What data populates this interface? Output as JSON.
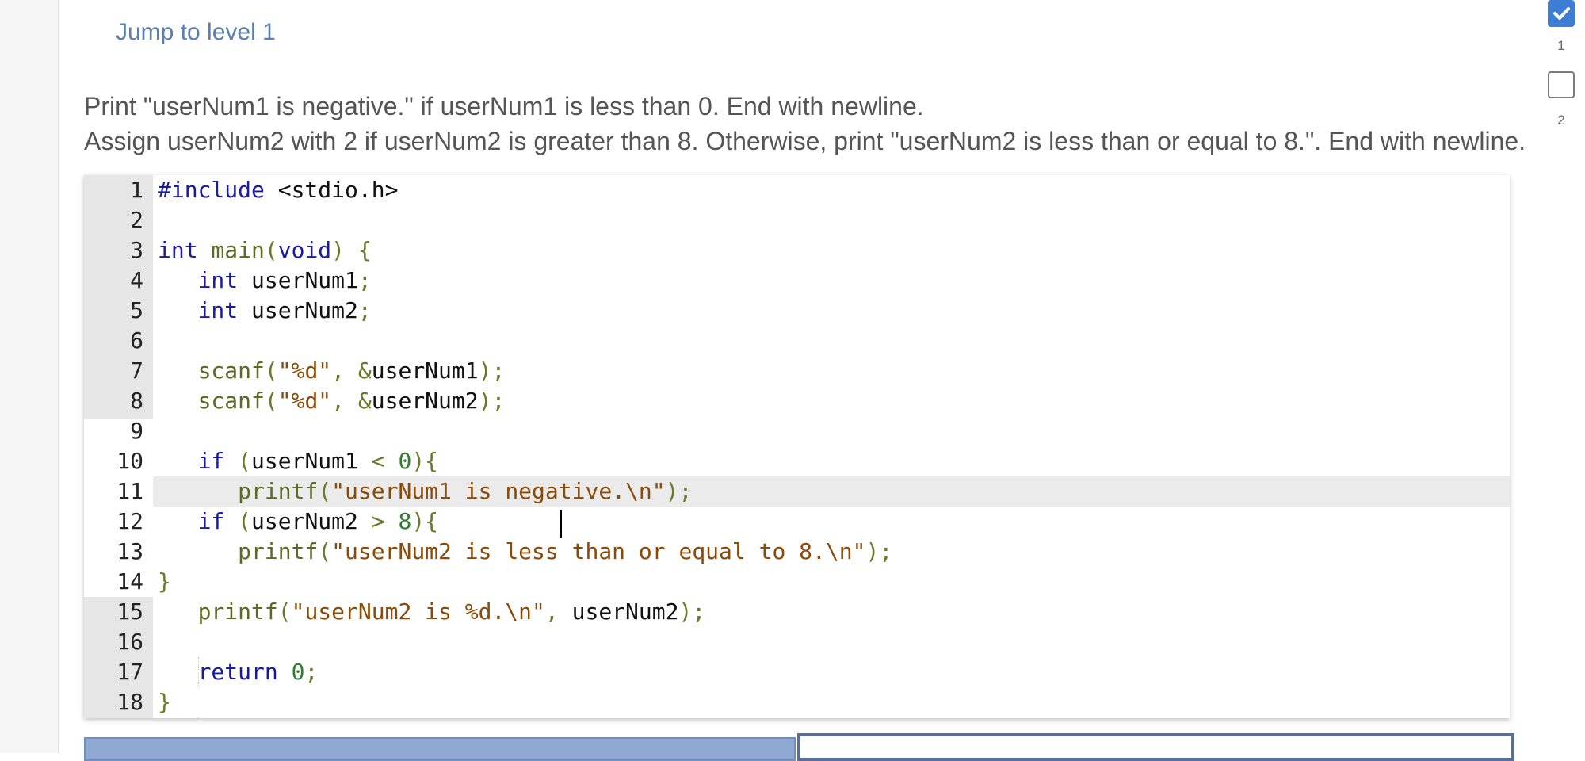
{
  "jump_link": "Jump to level 1",
  "instructions": [
    "Print \"userNum1 is negative.\" if userNum1 is less than 0. End with newline.",
    "Assign userNum2 with 2 if userNum2 is greater than 8. Otherwise, print \"userNum2 is less than or equal to 8.\". End with newline."
  ],
  "progress": {
    "levels": [
      {
        "number": "1",
        "state": "completed",
        "icon": "checkbox-checked-icon"
      },
      {
        "number": "2",
        "state": "incomplete",
        "icon": "checkbox-empty-icon"
      }
    ]
  },
  "editor": {
    "active_line": 11,
    "lines": [
      {
        "n": "1",
        "text": "#include <stdio.h>"
      },
      {
        "n": "2",
        "text": ""
      },
      {
        "n": "3",
        "text": "int main(void) {"
      },
      {
        "n": "4",
        "text": "   int userNum1;"
      },
      {
        "n": "5",
        "text": "   int userNum2;"
      },
      {
        "n": "6",
        "text": ""
      },
      {
        "n": "7",
        "text": "   scanf(\"%d\", &userNum1);"
      },
      {
        "n": "8",
        "text": "   scanf(\"%d\", &userNum2);"
      },
      {
        "n": "9",
        "text": ""
      },
      {
        "n": "10",
        "text": "   if (userNum1 < 0){"
      },
      {
        "n": "11",
        "text": "      printf(\"userNum1 is negative.\\n\");"
      },
      {
        "n": "12",
        "text": "   if (userNum2 > 8){"
      },
      {
        "n": "13",
        "text": "      printf(\"userNum2 is less than or equal to 8.\\n\");"
      },
      {
        "n": "14",
        "text": "}"
      },
      {
        "n": "15",
        "text": "   printf(\"userNum2 is %d.\\n\", userNum2);"
      },
      {
        "n": "16",
        "text": ""
      },
      {
        "n": "17",
        "text": "   return 0;"
      },
      {
        "n": "18",
        "text": "}"
      }
    ]
  },
  "colors": {
    "link": "#5a7fae",
    "keyword": "#1a1aa6",
    "string": "#8b4a06",
    "number": "#2e7d32",
    "checked": "#3d7ed4"
  }
}
